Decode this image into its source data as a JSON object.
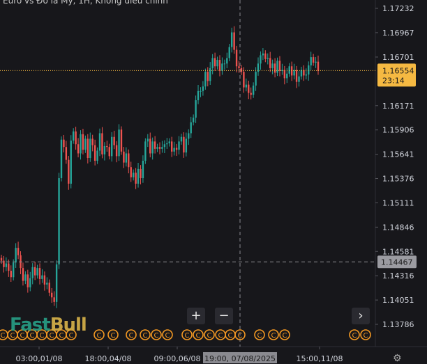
{
  "header": {
    "title": "Euro vs Đô la Mỹ, 1H, Không điều chỉnh"
  },
  "controls": {
    "zoom_in": "+",
    "zoom_out": "−",
    "scroll_right": "›"
  },
  "logo": {
    "part1": "Fast",
    "part2": "Bull"
  },
  "event_marker_symbol": "C",
  "colors": {
    "background": "#17171b",
    "up": "#26a69a",
    "down": "#ef5350",
    "price_tag": "#f5b942",
    "crosshair_tag": "#9b9ba1",
    "event_orange": "#f59a23"
  },
  "chart_data": {
    "type": "candlestick",
    "symbol": "EURUSD",
    "timeframe": "1H",
    "y_axis": {
      "ticks": [
        "1.17232",
        "1.16967",
        "1.16701",
        "1.16171",
        "1.15906",
        "1.15641",
        "1.15376",
        "1.15111",
        "1.14846",
        "1.14581",
        "1.14316",
        "1.14051",
        "1.13786"
      ],
      "range": [
        1.1368,
        1.1733
      ]
    },
    "x_axis": {
      "ticks": [
        "03:00,01/08",
        "18:00,04/08",
        "09:00,06/08",
        "15:00,11/08"
      ]
    },
    "current_price": {
      "value": "1.16554",
      "countdown": "23:14"
    },
    "crosshair": {
      "price": "1.14467",
      "time": "19:00, 07/08/2025"
    },
    "candles_close": [
      1.1448,
      1.1441,
      1.1445,
      1.1437,
      1.143,
      1.1446,
      1.1462,
      1.1454,
      1.144,
      1.1426,
      1.1433,
      1.1419,
      1.1429,
      1.1441,
      1.1432,
      1.144,
      1.1428,
      1.1432,
      1.1422,
      1.1424,
      1.1413,
      1.1408,
      1.1403,
      1.1444,
      1.1538,
      1.158,
      1.1572,
      1.1558,
      1.1532,
      1.1579,
      1.1589,
      1.1575,
      1.1565,
      1.1586,
      1.1569,
      1.1581,
      1.156,
      1.1581,
      1.1574,
      1.1557,
      1.1568,
      1.1587,
      1.1564,
      1.1573,
      1.1572,
      1.1562,
      1.1583,
      1.1574,
      1.1562,
      1.1591,
      1.1567,
      1.1555,
      1.1565,
      1.155,
      1.1539,
      1.1544,
      1.1532,
      1.1548,
      1.1538,
      1.1557,
      1.1578,
      1.1581,
      1.1565,
      1.1578,
      1.157,
      1.1572,
      1.157,
      1.1572,
      1.1575,
      1.1576,
      1.1578,
      1.1567,
      1.1571,
      1.1569,
      1.1578,
      1.1583,
      1.1566,
      1.1581,
      1.1587,
      1.1599,
      1.1604,
      1.1623,
      1.1633,
      1.1633,
      1.1638,
      1.1654,
      1.1644,
      1.1658,
      1.1669,
      1.166,
      1.1667,
      1.1655,
      1.1663,
      1.1663,
      1.1669,
      1.1681,
      1.1697,
      1.1678,
      1.166,
      1.1658,
      1.1654,
      1.1637,
      1.164,
      1.1631,
      1.1629,
      1.1639,
      1.1654,
      1.1663,
      1.1672,
      1.1674,
      1.1668,
      1.1669,
      1.1658,
      1.1663,
      1.1653,
      1.1666,
      1.1655,
      1.1656,
      1.1647,
      1.1652,
      1.166,
      1.165,
      1.1656,
      1.1643,
      1.1649,
      1.1656,
      1.165,
      1.1651,
      1.1661,
      1.167,
      1.1664,
      1.1665,
      1.1655
    ]
  }
}
